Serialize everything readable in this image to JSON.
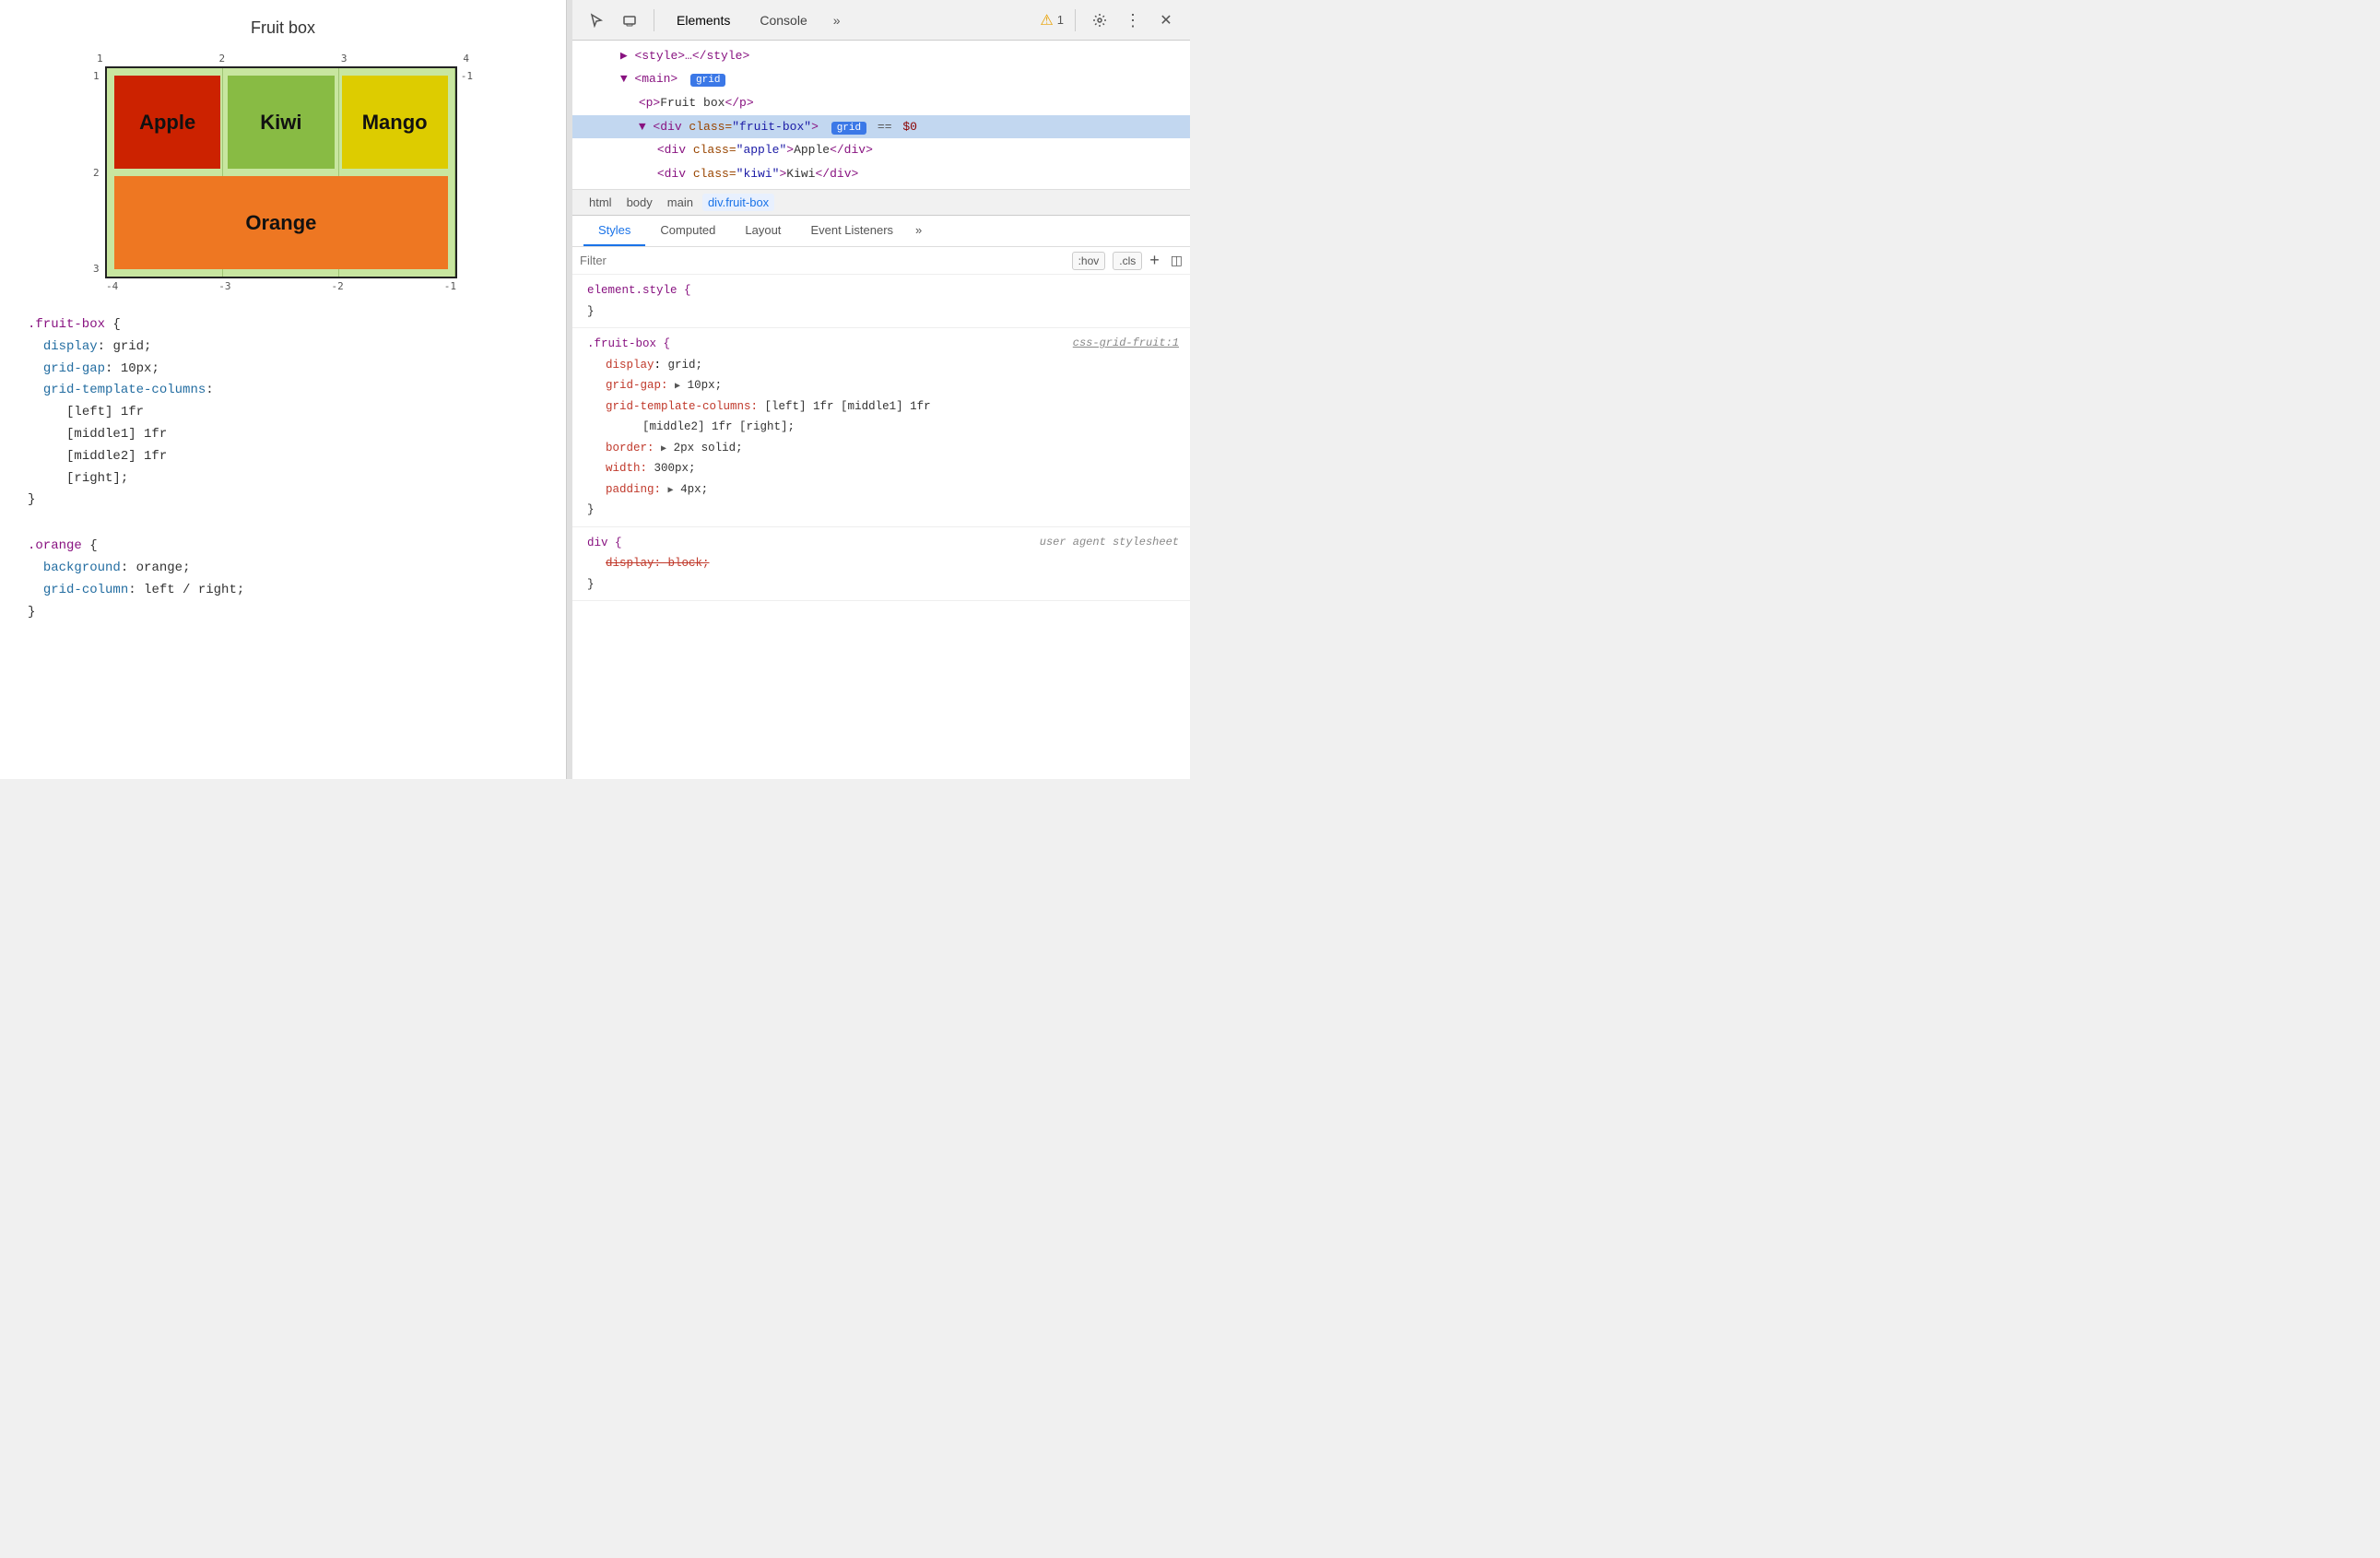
{
  "left": {
    "title": "Fruit box",
    "grid": {
      "topNumbers": [
        "1",
        "2",
        "3",
        "4"
      ],
      "sideNumbers": [
        "1",
        "2",
        "3"
      ],
      "rightNumbers": [
        "-1"
      ],
      "bottomNumbers": [
        "-4",
        "-3",
        "-2",
        "-1"
      ],
      "cells": [
        {
          "label": "Apple",
          "class": "apple"
        },
        {
          "label": "Kiwi",
          "class": "kiwi"
        },
        {
          "label": "Mango",
          "class": "mango"
        },
        {
          "label": "Orange",
          "class": "orange"
        }
      ]
    },
    "code_blocks": [
      {
        "selector": ".fruit-box",
        "props": [
          {
            "name": "display",
            "value": "grid;"
          },
          {
            "name": "grid-gap",
            "value": "10px;"
          },
          {
            "name": "grid-template-columns",
            "value": ""
          },
          {
            "name": null,
            "value": "[left] 1fr"
          },
          {
            "name": null,
            "value": "[middle1] 1fr"
          },
          {
            "name": null,
            "value": "[middle2] 1fr"
          },
          {
            "name": null,
            "value": "[right];"
          }
        ]
      },
      {
        "selector": ".orange",
        "props": [
          {
            "name": "background",
            "value": "orange;"
          },
          {
            "name": "grid-column",
            "value": "left / right;"
          }
        ]
      }
    ]
  },
  "right": {
    "toolbar": {
      "cursor_icon": "⬚",
      "device_icon": "▭",
      "tabs": [
        "Elements",
        "Console"
      ],
      "more_label": "»",
      "warning_count": "1",
      "settings_label": "⚙",
      "more_menu_label": "⋮",
      "close_label": "✕"
    },
    "dom": {
      "lines": [
        {
          "indent": 4,
          "content": "▶ <style>…</style>",
          "type": "tag"
        },
        {
          "indent": 4,
          "content": "▼ <main> ",
          "badge": "grid",
          "type": "tag"
        },
        {
          "indent": 6,
          "content": "<p>Fruit box</p>",
          "type": "tag"
        },
        {
          "indent": 6,
          "content": "▼ <div class=\"fruit-box\"> ",
          "badge": "grid",
          "eq": "== $0",
          "type": "tag",
          "selected": true
        },
        {
          "indent": 8,
          "content": "<div class=\"apple\">Apple</div>",
          "type": "tag"
        },
        {
          "indent": 8,
          "content": "<div class=\"kiwi\">Kiwi</div>",
          "type": "tag"
        }
      ]
    },
    "breadcrumb": {
      "items": [
        "html",
        "body",
        "main",
        "div.fruit-box"
      ]
    },
    "style_tabs": [
      "Styles",
      "Computed",
      "Layout",
      "Event Listeners",
      "»"
    ],
    "filter": {
      "placeholder": "Filter",
      "hov_label": ":hov",
      "cls_label": ".cls"
    },
    "rules": [
      {
        "selector": "element.style {",
        "close": "}",
        "source": "",
        "props": []
      },
      {
        "selector": ".fruit-box {",
        "source": "css-grid-fruit:1",
        "props": [
          {
            "name": "display",
            "value": "grid;"
          },
          {
            "name": "grid-gap",
            "value": "▶ 10px;"
          },
          {
            "name": "grid-template-columns",
            "value": "[left] 1fr [middle1] 1fr"
          },
          {
            "name": null,
            "value": "[middle2] 1fr [right];"
          },
          {
            "name": "border",
            "value": "▶ 2px solid;"
          },
          {
            "name": "width",
            "value": "300px;"
          },
          {
            "name": "padding",
            "value": "▶ 4px;"
          }
        ],
        "close": "}"
      },
      {
        "selector": "div {",
        "source": "user agent stylesheet",
        "props": [
          {
            "name": "display: block;",
            "strikethrough": true
          }
        ],
        "close": "}"
      }
    ]
  }
}
